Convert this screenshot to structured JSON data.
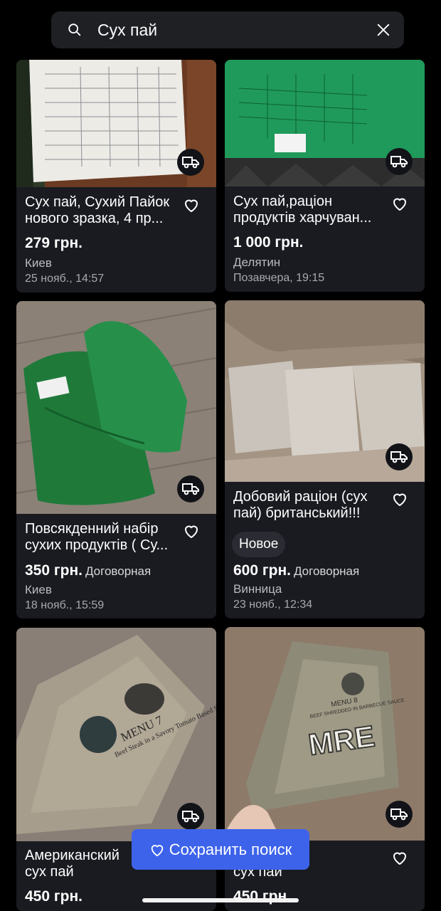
{
  "search": {
    "query": "Сух пай"
  },
  "listings": [
    {
      "title": "Сух пай, Сухий Пайок\nнового зразка, 4 пр...",
      "price": "279 грн.",
      "negotiable": "",
      "city": "Киев",
      "date": "25 нояб., 14:57",
      "badge": ""
    },
    {
      "title": "Сух пай,раціон\nпродуктів харчуван...",
      "price": "1 000 грн.",
      "negotiable": "",
      "city": "Делятин",
      "date": "Позавчера, 19:15",
      "badge": ""
    },
    {
      "title": "Повсякденний набір\nсухих продуктів ( Су...",
      "price": "350 грн.",
      "negotiable": "Договорная",
      "city": "Киев",
      "date": "18 нояб., 15:59",
      "badge": ""
    },
    {
      "title": "Добовий раціон (сух\nпай) британський!!!",
      "price": "600 грн.",
      "negotiable": "Договорная",
      "city": "Винница",
      "date": "23 нояб., 12:34",
      "badge": "Новое"
    },
    {
      "title": "Американский\nсух пай",
      "price": "450 грн.",
      "negotiable": "",
      "city": "",
      "date": "",
      "badge": ""
    },
    {
      "title": "...кий\nсух пай",
      "price": "450 грн.",
      "negotiable": "",
      "city": "",
      "date": "",
      "badge": ""
    }
  ],
  "photo_texts": {
    "mre_logo": "MRE",
    "mre_menu": "MENU 8",
    "mre_desc": "BEEF SHREDDED IN BARBECUE SAUCE",
    "us_menu": "MENU 7",
    "us_desc": "Beef Steak in a Savory Tomato Based Sauce"
  },
  "save_button": {
    "label": "Сохранить поиск"
  },
  "icons": [
    "search-icon",
    "close-icon",
    "truck-icon",
    "heart-icon"
  ]
}
